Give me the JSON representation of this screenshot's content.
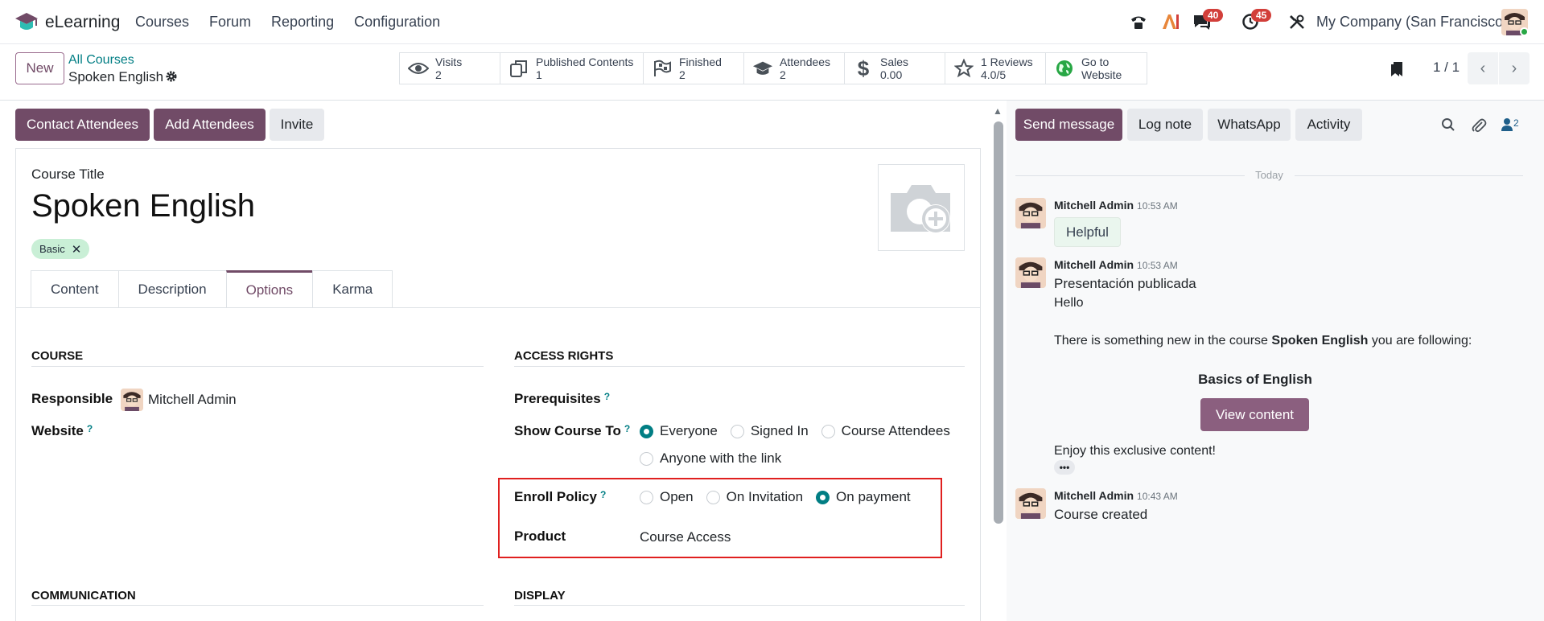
{
  "navbar": {
    "app_name": "eLearning",
    "menu": [
      "Courses",
      "Forum",
      "Reporting",
      "Configuration"
    ],
    "messages_badge": "40",
    "activities_badge": "45",
    "company": "My Company (San Francisco)"
  },
  "control": {
    "new_label": "New",
    "breadcrumb_parent": "All Courses",
    "breadcrumb_current": "Spoken English",
    "pager": "1 / 1"
  },
  "stats": [
    {
      "label": "Visits",
      "value": "2",
      "icon": "eye-icon"
    },
    {
      "label": "Published Contents",
      "value": "1",
      "icon": "copy-icon"
    },
    {
      "label": "Finished",
      "value": "2",
      "icon": "flag-checkered-icon"
    },
    {
      "label": "Attendees",
      "value": "2",
      "icon": "graduation-cap-icon"
    },
    {
      "label": "Sales",
      "value": "0.00",
      "icon": "dollar-icon"
    },
    {
      "label": "1 Reviews",
      "value": "4.0/5",
      "icon": "star-icon"
    },
    {
      "label": "Go to",
      "value": "Website",
      "icon": "globe-icon"
    }
  ],
  "actions": {
    "contact": "Contact Attendees",
    "add": "Add Attendees",
    "invite": "Invite"
  },
  "form": {
    "title_label": "Course Title",
    "title": "Spoken English",
    "tag": "Basic",
    "tabs": [
      "Content",
      "Description",
      "Options",
      "Karma"
    ],
    "active_tab": "Options",
    "course_section": "COURSE",
    "responsible_label": "Responsible",
    "responsible_value": "Mitchell Admin",
    "website_label": "Website",
    "access_section": "ACCESS RIGHTS",
    "prereq_label": "Prerequisites",
    "show_label": "Show Course To",
    "show_options": [
      "Everyone",
      "Signed In",
      "Course Attendees",
      "Anyone with the link"
    ],
    "show_selected": "Everyone",
    "enroll_label": "Enroll Policy",
    "enroll_options": [
      "Open",
      "On Invitation",
      "On payment"
    ],
    "enroll_selected": "On payment",
    "product_label": "Product",
    "product_value": "Course Access",
    "communication_section": "COMMUNICATION",
    "display_section": "DISPLAY",
    "help_mark": "?"
  },
  "chatter": {
    "send": "Send message",
    "log": "Log note",
    "whatsapp": "WhatsApp",
    "activity": "Activity",
    "followers_count": "2",
    "today": "Today",
    "messages": [
      {
        "author": "Mitchell Admin",
        "time": "10:53 AM",
        "bubble": "Helpful"
      },
      {
        "author": "Mitchell Admin",
        "time": "10:53 AM",
        "line1": "Presentación publicada",
        "line2": "Hello",
        "line3_pre": "There is something new in the course ",
        "line3_bold": "Spoken English",
        "line3_post": " you are following:",
        "content_title": "Basics of English",
        "button": "View content",
        "footer": "Enjoy this exclusive content!"
      },
      {
        "author": "Mitchell Admin",
        "time": "10:43 AM",
        "text": "Course created"
      }
    ]
  },
  "colors": {
    "brand": "#714b67",
    "accent": "#017e84",
    "highlight_box": "#e0201f",
    "badge": "#d23f3a"
  }
}
